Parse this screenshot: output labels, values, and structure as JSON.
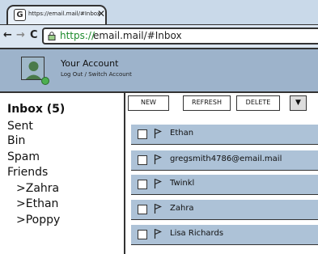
{
  "browser": {
    "tab": {
      "icon_letter": "G",
      "title": "https://email.mail/#Inbox",
      "close": "✕"
    },
    "nav": {
      "back": "←",
      "forward": "→",
      "reload": "C"
    },
    "url": {
      "scheme": "https://",
      "rest": "email.mail/#Inbox"
    }
  },
  "account": {
    "name": "Your Account",
    "links": "Log Out / Switch Account"
  },
  "sidebar": {
    "folders": [
      {
        "label": "Inbox (5)"
      },
      {
        "label": "Sent"
      },
      {
        "label": "Bin"
      },
      {
        "label": "Spam"
      },
      {
        "label": "Friends"
      },
      {
        "label": ">Zahra"
      },
      {
        "label": ">Ethan"
      },
      {
        "label": ">Poppy"
      }
    ]
  },
  "toolbar": {
    "new_label": "NEW",
    "refresh_label": "REFRESH",
    "delete_label": "DELETE",
    "more_label": "▼"
  },
  "emails": [
    {
      "sender": "Ethan"
    },
    {
      "sender": "gregsmith4786@email.mail"
    },
    {
      "sender": "Twinkl"
    },
    {
      "sender": "Zahra"
    },
    {
      "sender": "Lisa Richards"
    }
  ],
  "colors": {
    "url_secure": "#1d8a2c",
    "row_background": "#adc2d7",
    "header_background": "#9db3cb"
  }
}
